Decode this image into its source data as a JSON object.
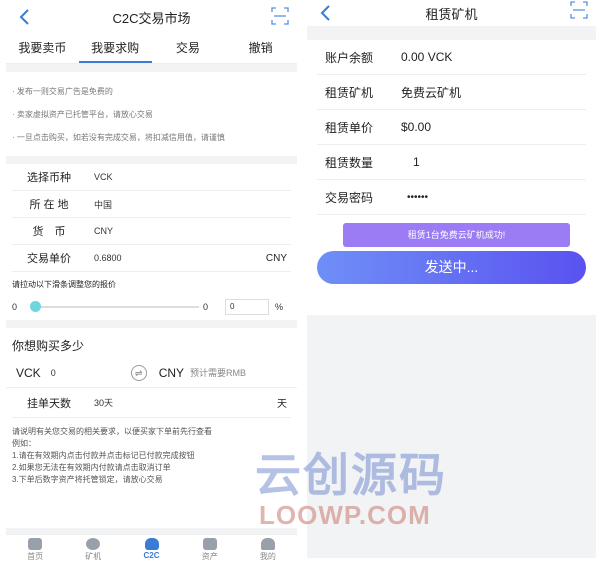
{
  "left": {
    "nav": {
      "title": "C2C交易市场"
    },
    "tabs": [
      {
        "label": "我要卖币"
      },
      {
        "label": "我要求购"
      },
      {
        "label": "交易"
      },
      {
        "label": "撤销"
      }
    ],
    "notices": [
      "· 发布一则交易广告是免费的",
      "· 卖家虚拟资产已托管平台，请放心交易",
      "· 一旦点击购买，如若没有完成交易，将扣减信用值，请谨慎"
    ],
    "form": {
      "coin_label": "选择币种",
      "coin_value": "VCK",
      "location_label": "所 在 地",
      "location_value": "中国",
      "currency_label": "货　币",
      "currency_value": "CNY",
      "price_label": "交易单价",
      "price_value": "0.6800",
      "price_unit": "CNY"
    },
    "slider": {
      "title": "请拉动以下滑条调整您的报价",
      "min": "0",
      "current": "0",
      "input_value": "0",
      "unit": "%"
    },
    "buy": {
      "title": "你想购买多少",
      "cur_from": "VCK",
      "amount": "0",
      "cur_to": "CNY",
      "hint": "预计需要RMB",
      "days_label": "挂单天数",
      "days_value": "30天",
      "days_unit": "天"
    },
    "notes": [
      "请说明有关您交易的相关要求，以便买家下单前先行查看",
      "例如：",
      "1.请在有效期内点击付款并点击标记已付款完成按钮",
      "2.如果您无法在有效期内付款请点击取消订单",
      "3.下单后数字资产将托管锁定，请放心交易"
    ],
    "bottom_nav": [
      {
        "label": "首页"
      },
      {
        "label": "矿机"
      },
      {
        "label": "C2C"
      },
      {
        "label": "资产"
      },
      {
        "label": "我的"
      }
    ]
  },
  "right": {
    "nav": {
      "title": "租赁矿机"
    },
    "rows": [
      {
        "label": "账户余额",
        "value": "0.00 VCK"
      },
      {
        "label": "租赁矿机",
        "value": "免费云矿机"
      },
      {
        "label": "租赁单价",
        "value": "$0.00"
      },
      {
        "label": "租赁数量",
        "value": "1"
      },
      {
        "label": "交易密码",
        "value": "••••••"
      }
    ],
    "toast": "租赁1台免费云矿机成功!",
    "send_label": "发送中..."
  },
  "watermark": {
    "cn": "云创源码",
    "en": "LOOWP.COM"
  },
  "colors": {
    "accent": "#3a7bd5",
    "toast": "#9b7cf4",
    "button_start": "#6f8ff7",
    "button_end": "#5a52f0"
  }
}
